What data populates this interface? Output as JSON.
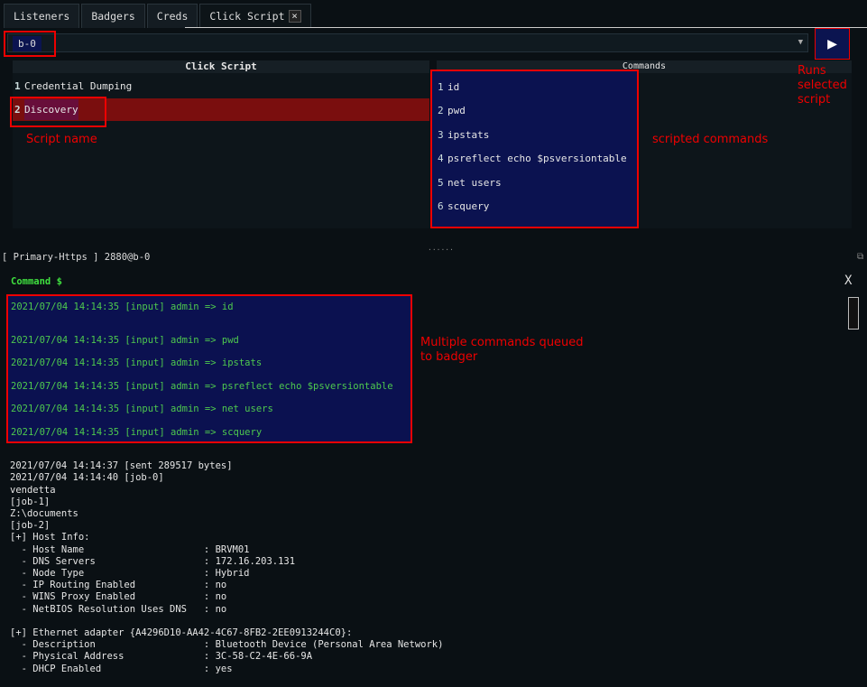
{
  "tabs": [
    {
      "label": "Listeners"
    },
    {
      "label": "Badgers"
    },
    {
      "label": "Creds"
    },
    {
      "label": "Click Script",
      "close": "×"
    }
  ],
  "badger_select": {
    "value": "b-0"
  },
  "run_button": {
    "icon": "play-icon",
    "label": "▶"
  },
  "scripts": {
    "header": "Click Script",
    "items": [
      {
        "n": "1",
        "name": "Credential Dumping"
      },
      {
        "n": "2",
        "name": "Discovery",
        "selected": true
      }
    ]
  },
  "commands": {
    "header": "Commands",
    "items": [
      {
        "n": "1",
        "cmd": "id"
      },
      {
        "n": "2",
        "cmd": "pwd"
      },
      {
        "n": "3",
        "cmd": "ipstats"
      },
      {
        "n": "4",
        "cmd": "psreflect echo $psversiontable"
      },
      {
        "n": "5",
        "cmd": "net users"
      },
      {
        "n": "6",
        "cmd": "scquery"
      }
    ]
  },
  "annotations": {
    "runs": "Runs\nselected\nscript",
    "script_name": "Script name",
    "scripted": "scripted commands",
    "queued": "Multiple commands queued\nto badger"
  },
  "status": "[ Primary-Https ] 2880@b-0",
  "console": {
    "prompt": "Command $",
    "close": "X",
    "inputs": [
      "2021/07/04 14:14:35 [input] admin => id",
      "2021/07/04 14:14:35 [input] admin => pwd",
      "2021/07/04 14:14:35 [input] admin => ipstats",
      "2021/07/04 14:14:35 [input] admin => psreflect echo $psversiontable",
      "2021/07/04 14:14:35 [input] admin => net users",
      "2021/07/04 14:14:35 [input] admin => scquery"
    ],
    "output": [
      "2021/07/04 14:14:37 [sent 289517 bytes]",
      "2021/07/04 14:14:40 [job-0]",
      "vendetta",
      "[job-1]",
      "Z:\\documents",
      "[job-2]",
      "[+] Host Info:",
      "  - Host Name                     : BRVM01",
      "  - DNS Servers                   : 172.16.203.131",
      "  - Node Type                     : Hybrid",
      "  - IP Routing Enabled            : no",
      "  - WINS Proxy Enabled            : no",
      "  - NetBIOS Resolution Uses DNS   : no",
      "",
      "[+] Ethernet adapter {A4296D10-AA42-4C67-8FB2-2EE0913244C0}:",
      "  - Description                   : Bluetooth Device (Personal Area Network)",
      "  - Physical Address              : 3C-58-C2-4E-66-9A",
      "  - DHCP Enabled                  : yes"
    ]
  },
  "colors": {
    "annotation": "#ee0000",
    "selected_row": "#7a0e0e",
    "highlight": "#0b1450",
    "console_input": "#4ec94e"
  }
}
